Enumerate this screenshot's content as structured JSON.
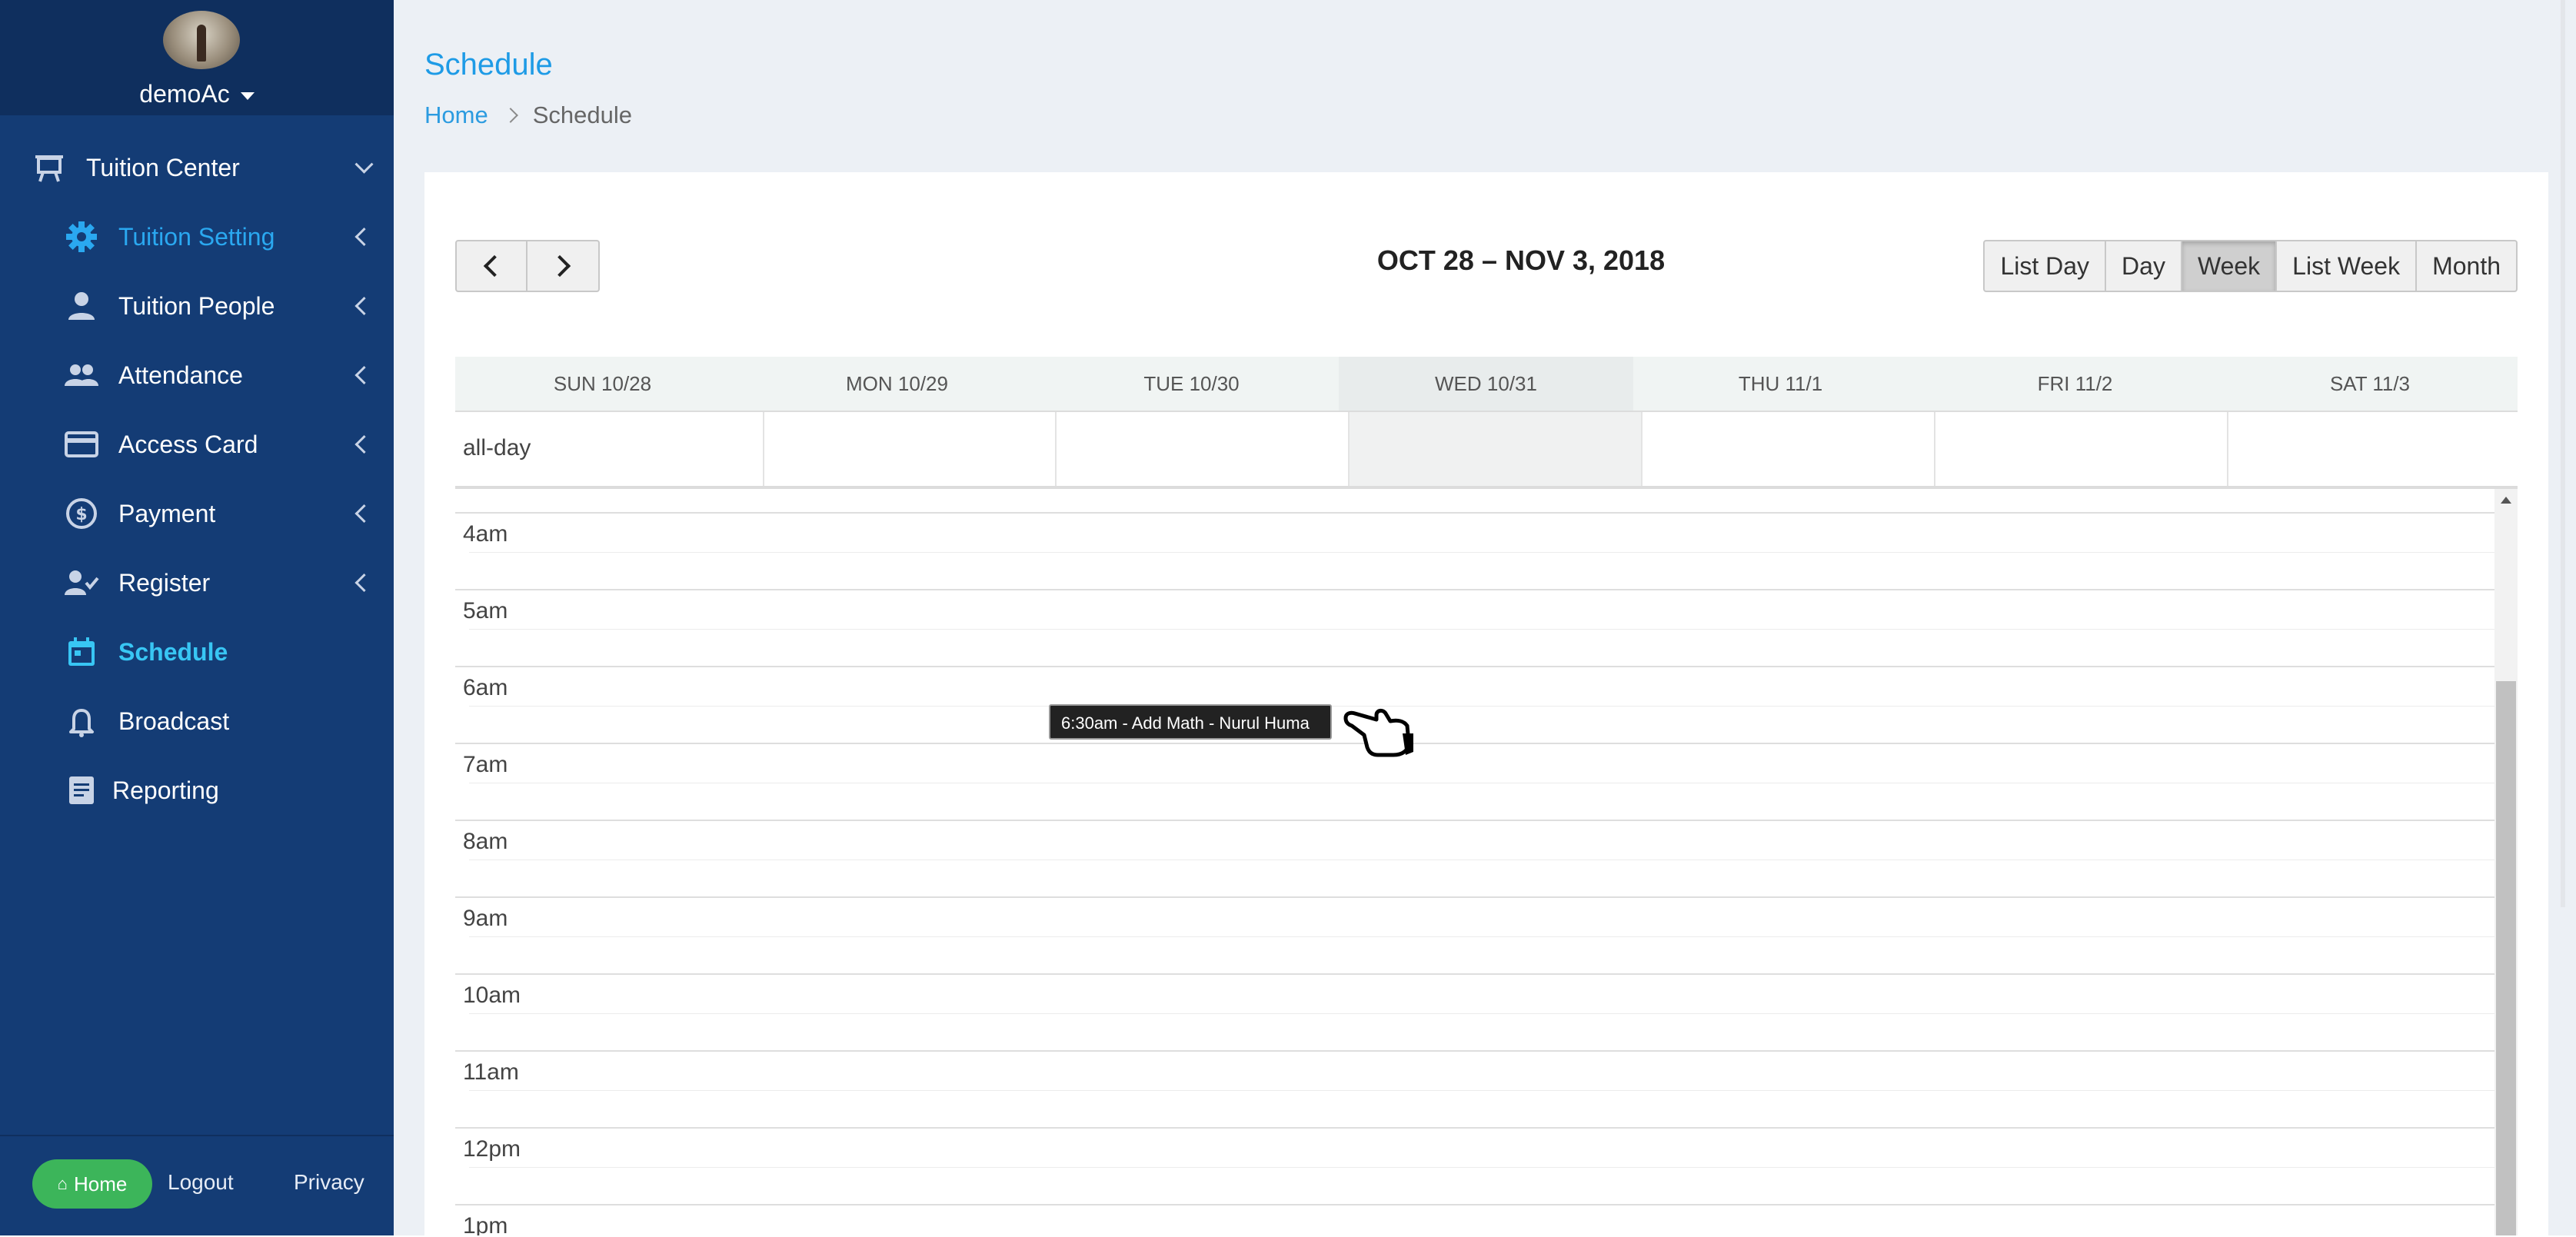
{
  "sidebar": {
    "username": "demoAc",
    "items": [
      {
        "label": "Tuition Center",
        "icon": "presentation-board-icon"
      },
      {
        "label": "Tuition Setting",
        "icon": "gear-icon"
      },
      {
        "label": "Tuition People",
        "icon": "person-icon"
      },
      {
        "label": "Attendance",
        "icon": "people-group-icon"
      },
      {
        "label": "Access Card",
        "icon": "credit-card-icon"
      },
      {
        "label": "Payment",
        "icon": "dollar-circle-icon"
      },
      {
        "label": "Register",
        "icon": "user-check-icon"
      },
      {
        "label": "Schedule",
        "icon": "calendar-icon"
      },
      {
        "label": "Broadcast",
        "icon": "bell-icon"
      },
      {
        "label": "Reporting",
        "icon": "report-icon"
      }
    ],
    "footer": {
      "home": "Home",
      "logout": "Logout",
      "privacy": "Privacy"
    },
    "colors": {
      "background": "#143c75",
      "active_setting": "#2aa8f0",
      "active_schedule": "#38c6f4",
      "home_button": "#3cb55a"
    }
  },
  "main": {
    "title": "Schedule",
    "breadcrumb": {
      "home": "Home",
      "current": "Schedule"
    }
  },
  "calendar": {
    "range_title": "OCT 28 – NOV 3, 2018",
    "views": {
      "list_day": "List Day",
      "day": "Day",
      "week": "Week",
      "list_week": "List Week",
      "month": "Month"
    },
    "active_view": "Week",
    "days": [
      "SUN 10/28",
      "MON 10/29",
      "TUE 10/30",
      "WED 10/31",
      "THU 11/1",
      "FRI 11/2",
      "SAT 11/3"
    ],
    "today": "WED 10/31",
    "allday_label": "all-day",
    "hours": [
      "4am",
      "5am",
      "6am",
      "7am",
      "8am",
      "9am",
      "10am",
      "11am",
      "12pm",
      "1pm"
    ],
    "tooltip": "6:30am - Add Math - Nurul Huma"
  }
}
